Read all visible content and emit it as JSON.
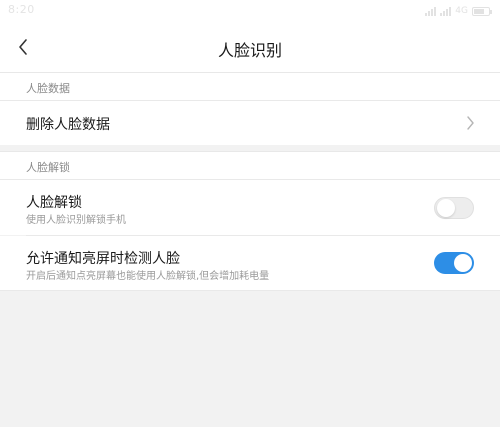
{
  "status_bar": {
    "time": "8:20",
    "network": "4G"
  },
  "header": {
    "title": "人脸识别"
  },
  "sections": [
    {
      "label": "人脸数据",
      "items": [
        {
          "title": "删除人脸数据"
        }
      ]
    },
    {
      "label": "人脸解锁",
      "items": [
        {
          "title": "人脸解锁",
          "subtitle": "使用人脸识别解锁手机",
          "toggle": "off"
        },
        {
          "title": "允许通知亮屏时检测人脸",
          "subtitle": "开启后通知点亮屏幕也能使用人脸解锁,但会增加耗电量",
          "toggle": "on"
        }
      ]
    }
  ],
  "colors": {
    "accent": "#2d8ee6",
    "background": "#f2f2f2"
  },
  "icons": {
    "back": "chevron-left-icon",
    "row_arrow": "chevron-right-icon"
  }
}
